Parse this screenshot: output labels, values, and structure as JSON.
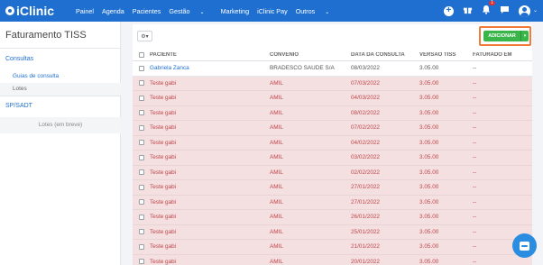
{
  "app": {
    "brand": "iClinic"
  },
  "nav": {
    "items": [
      "Painel",
      "Agenda",
      "Pacientes",
      "Gestão",
      "Marketing",
      "iClinic Pay",
      "Outros"
    ],
    "caret": "⌄",
    "notification_count": "1"
  },
  "icons": [
    "add-icon",
    "gift-icon",
    "bell-icon",
    "chat-icon",
    "user-avatar-icon",
    "gear-icon",
    "caret-down-icon",
    "chat-bubble-icon"
  ],
  "colors": {
    "primary": "#1e6fd0",
    "success": "#39b54a",
    "highlight": "#f07b3a",
    "row_pink": "#f4dfe1",
    "row_text": "#c0474a"
  },
  "sidebar": {
    "title": "Faturamento TISS",
    "section_consultas": "Consultas",
    "sub_guias": "Guias de consulta",
    "sub_lotes": "Lotes",
    "section_spsadt": "SP/SADT",
    "footer": "Lotes (em breve)"
  },
  "toolbar": {
    "settings_label": "⚙▾",
    "add_label": "ADICIONAR",
    "add_caret": "▾"
  },
  "table": {
    "headers": [
      "PACIENTE",
      "CONVÊNIO",
      "DATA DA CONSULTA",
      "VERSÃO TISS",
      "FATURADO EM"
    ],
    "rows": [
      [
        "Gabriela Zanca",
        "BRADESCO SAUDE S/A",
        "08/03/2022",
        "3.05.00",
        "--"
      ],
      [
        "Teste gabi",
        "AMIL",
        "07/03/2022",
        "3.05.00",
        "--"
      ],
      [
        "Teste gabi",
        "AMIL",
        "04/03/2022",
        "3.05.00",
        "--"
      ],
      [
        "Teste gabi",
        "AMIL",
        "08/02/2022",
        "3.05.00",
        "--"
      ],
      [
        "Teste gabi",
        "AMIL",
        "07/02/2022",
        "3.05.00",
        "--"
      ],
      [
        "Teste gabi",
        "AMIL",
        "04/02/2022",
        "3.05.00",
        "--"
      ],
      [
        "Teste gabi",
        "AMIL",
        "03/02/2022",
        "3.05.00",
        "--"
      ],
      [
        "Teste gabi",
        "AMIL",
        "02/02/2022",
        "3.05.00",
        "--"
      ],
      [
        "Teste gabi",
        "AMIL",
        "27/01/2022",
        "3.05.00",
        "--"
      ],
      [
        "Teste gabi",
        "AMIL",
        "27/01/2022",
        "3.05.00",
        "--"
      ],
      [
        "Teste gabi",
        "AMIL",
        "26/01/2022",
        "3.05.00",
        "--"
      ],
      [
        "Teste gabi",
        "AMIL",
        "25/01/2022",
        "3.05.00",
        "--"
      ],
      [
        "Teste gabi",
        "AMIL",
        "21/01/2022",
        "3.05.00",
        "--"
      ],
      [
        "Teste gabi",
        "AMIL",
        "20/01/2022",
        "3.05.00",
        "--"
      ]
    ]
  }
}
